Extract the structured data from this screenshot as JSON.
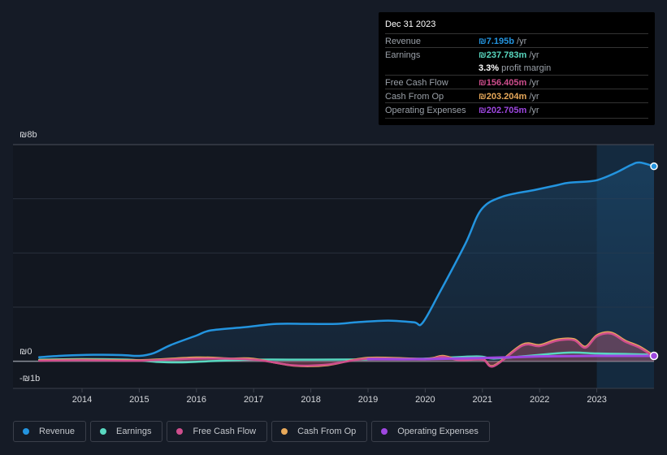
{
  "tooltip": {
    "date": "Dec 31 2023",
    "rows": [
      {
        "label": "Revenue",
        "value": "₪7.195b",
        "unit": "/yr",
        "color": "#2394df"
      },
      {
        "label": "Earnings",
        "value": "₪237.783m",
        "unit": "/yr",
        "color": "#59d8c0"
      },
      {
        "label": "",
        "value": "3.3%",
        "unit": "profit margin",
        "color": "#ffffff"
      },
      {
        "label": "Free Cash Flow",
        "value": "₪156.405m",
        "unit": "/yr",
        "color": "#cf4e8d"
      },
      {
        "label": "Cash From Op",
        "value": "₪203.204m",
        "unit": "/yr",
        "color": "#e8a95a"
      },
      {
        "label": "Operating Expenses",
        "value": "₪202.705m",
        "unit": "/yr",
        "color": "#9e47e0"
      }
    ]
  },
  "chart_data": {
    "type": "area",
    "title": "",
    "xlabel": "",
    "ylabel": "",
    "y_unit": "₪ billions",
    "ylim": [
      -1,
      8
    ],
    "xlim": [
      2013.25,
      2024.0
    ],
    "y_tick_labels": [
      {
        "value": 8,
        "label": "₪8b"
      },
      {
        "value": 0,
        "label": "₪0"
      },
      {
        "value": -1,
        "label": "-₪1b"
      }
    ],
    "y_gridlines": [
      8,
      6,
      4,
      2,
      0
    ],
    "x_ticks": [
      2014,
      2015,
      2016,
      2017,
      2018,
      2019,
      2020,
      2021,
      2022,
      2023
    ],
    "x_tick_labels": [
      "2014",
      "2015",
      "2016",
      "2017",
      "2018",
      "2019",
      "2020",
      "2021",
      "2022",
      "2023"
    ],
    "highlight_start": 2023.0,
    "legend_position": "bottom-left",
    "series": [
      {
        "name": "Revenue",
        "color": "#2394df",
        "fill": true,
        "x": [
          2013.25,
          2013.7,
          2014.2,
          2014.7,
          2015.0,
          2015.25,
          2015.55,
          2016.0,
          2016.25,
          2016.85,
          2017.4,
          2017.95,
          2018.45,
          2018.8,
          2019.35,
          2019.8,
          2019.95,
          2020.25,
          2020.7,
          2020.98,
          2021.35,
          2021.9,
          2022.3,
          2022.5,
          2022.9,
          2023.08,
          2023.35,
          2023.6,
          2023.75,
          2024.0
        ],
        "values": [
          0.15,
          0.21,
          0.24,
          0.23,
          0.2,
          0.3,
          0.6,
          0.95,
          1.14,
          1.26,
          1.38,
          1.38,
          1.38,
          1.44,
          1.5,
          1.44,
          1.41,
          2.53,
          4.33,
          5.6,
          6.08,
          6.32,
          6.5,
          6.59,
          6.65,
          6.74,
          6.98,
          7.25,
          7.34,
          7.2
        ]
      },
      {
        "name": "Earnings",
        "color": "#59d8c0",
        "fill": false,
        "x": [
          2013.25,
          2014.0,
          2014.8,
          2015.3,
          2015.7,
          2016.2,
          2017.0,
          2018.0,
          2019.0,
          2020.0,
          2020.9,
          2021.2,
          2021.8,
          2022.5,
          2023.0,
          2023.5,
          2024.0
        ],
        "values": [
          0.06,
          0.08,
          0.06,
          -0.02,
          -0.04,
          0.0,
          0.06,
          0.06,
          0.07,
          0.1,
          0.18,
          0.1,
          0.2,
          0.32,
          0.29,
          0.27,
          0.24
        ]
      },
      {
        "name": "Free Cash Flow",
        "color": "#cf4e8d",
        "fill": true,
        "x": [
          2013.25,
          2014.0,
          2015.0,
          2016.0,
          2017.0,
          2017.7,
          2018.3,
          2019.0,
          2020.0,
          2020.3,
          2020.6,
          2021.0,
          2021.2,
          2021.7,
          2022.0,
          2022.3,
          2022.6,
          2022.8,
          2023.0,
          2023.25,
          2023.5,
          2023.75,
          2024.0
        ],
        "values": [
          0.02,
          0.04,
          0.02,
          0.1,
          0.06,
          -0.15,
          -0.12,
          0.1,
          0.07,
          0.17,
          0.04,
          0.06,
          -0.18,
          0.58,
          0.56,
          0.76,
          0.78,
          0.5,
          0.92,
          1.02,
          0.72,
          0.5,
          0.16
        ]
      },
      {
        "name": "Cash From Op",
        "color": "#e8a95a",
        "fill": false,
        "x": [
          2013.25,
          2014.0,
          2015.0,
          2016.0,
          2016.6,
          2017.0,
          2017.7,
          2018.3,
          2019.0,
          2020.0,
          2020.3,
          2020.6,
          2021.0,
          2021.2,
          2021.7,
          2022.0,
          2022.3,
          2022.6,
          2022.8,
          2023.0,
          2023.25,
          2023.5,
          2023.75,
          2024.0
        ],
        "values": [
          0.04,
          0.06,
          0.04,
          0.14,
          0.1,
          0.09,
          -0.16,
          -0.14,
          0.13,
          0.09,
          0.2,
          0.06,
          0.08,
          -0.16,
          0.62,
          0.6,
          0.8,
          0.82,
          0.54,
          0.96,
          1.06,
          0.76,
          0.54,
          0.2
        ]
      },
      {
        "name": "Operating Expenses",
        "color": "#9e47e0",
        "fill": false,
        "x": [
          2019.0,
          2020.0,
          2021.0,
          2022.0,
          2023.0,
          2024.0
        ],
        "values": [
          0.08,
          0.08,
          0.12,
          0.18,
          0.2,
          0.2
        ]
      }
    ]
  },
  "legend": [
    {
      "label": "Revenue",
      "color": "#2394df"
    },
    {
      "label": "Earnings",
      "color": "#59d8c0"
    },
    {
      "label": "Free Cash Flow",
      "color": "#cf4e8d"
    },
    {
      "label": "Cash From Op",
      "color": "#e8a95a"
    },
    {
      "label": "Operating Expenses",
      "color": "#9e47e0"
    }
  ]
}
